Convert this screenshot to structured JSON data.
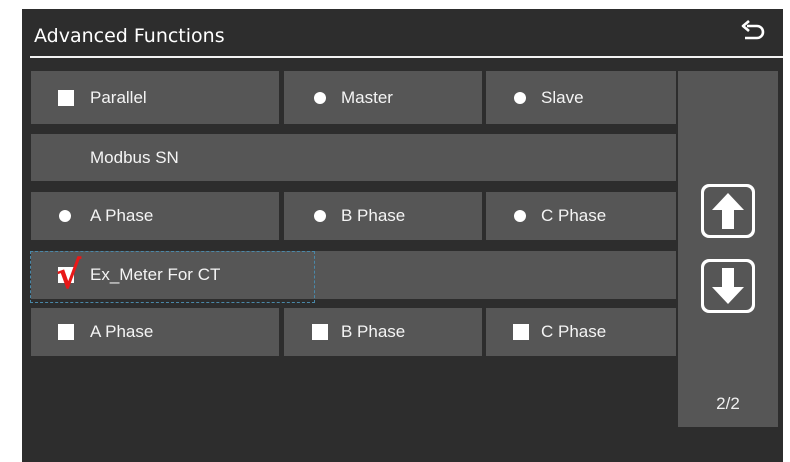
{
  "header": {
    "title": "Advanced Functions",
    "back_icon": "back-arrow-icon"
  },
  "rows": {
    "parallel": {
      "label": "Parallel",
      "master": "Master",
      "slave": "Slave"
    },
    "modbus": {
      "label": "Modbus SN"
    },
    "phase1": {
      "a": "A Phase",
      "b": "B Phase",
      "c": "C Phase"
    },
    "ex_meter": {
      "label": "Ex_Meter For CT",
      "checked": true,
      "check_mark": "√"
    },
    "phase2": {
      "a": "A Phase",
      "b": "B Phase",
      "c": "C Phase"
    }
  },
  "pager": {
    "up_icon": "arrow-up-icon",
    "down_icon": "arrow-down-icon",
    "indicator": "2/2"
  },
  "colors": {
    "background": "#2d2d2d",
    "tile": "#565656",
    "text": "#ffffff",
    "check": "#e81818"
  }
}
